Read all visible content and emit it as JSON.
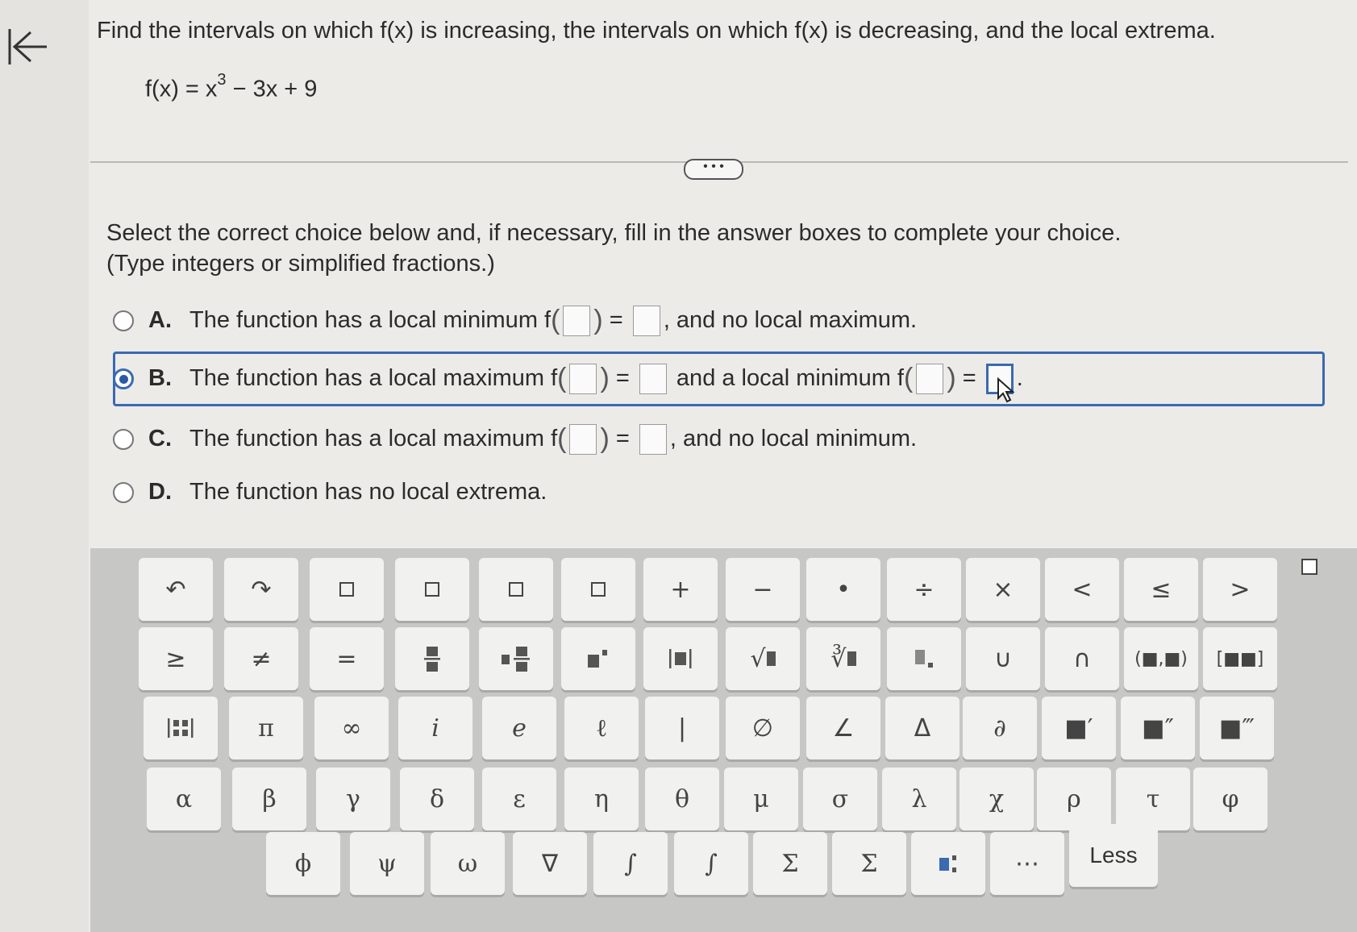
{
  "question": {
    "text": "Find the intervals on which f(x) is increasing, the intervals on which f(x) is decreasing, and the local extrema.",
    "formula_lhs": "f(x) = x",
    "formula_exp": "3",
    "formula_rhs": " − 3x + 9"
  },
  "more_button": "• • •",
  "instruction": {
    "line1": "Select the correct choice below and, if necessary, fill in the answer boxes to complete your choice.",
    "line2": "(Type integers or simplified fractions.)"
  },
  "choices": {
    "a": {
      "letter": "A.",
      "pre": "The function has a local minimum f",
      "mid": " = ",
      "post": ", and no local maximum."
    },
    "b": {
      "letter": "B.",
      "pre": "The function has a local maximum f",
      "mid": " = ",
      "mid2": " and a local minimum f",
      "mid3": " = ",
      "post": "."
    },
    "c": {
      "letter": "C.",
      "pre": "The function has a local maximum f",
      "mid": " = ",
      "post": ", and no local minimum."
    },
    "d": {
      "letter": "D.",
      "text": "The function has no local extrema."
    },
    "selected": "B"
  },
  "keyboard": {
    "row1": [
      "↶",
      "↷",
      "",
      "",
      "",
      "",
      "+",
      "−",
      "•",
      "÷",
      "×",
      "<",
      "≤",
      ">"
    ],
    "row2": [
      "≥",
      "≠",
      "=",
      "",
      "",
      "",
      "",
      "√",
      "∛",
      "",
      "∪",
      "∩",
      "(■,■)",
      "[■■]"
    ],
    "row3": [
      "",
      "π",
      "∞",
      "i",
      "e",
      "ℓ",
      "|",
      "∅",
      "∠",
      "Δ",
      "∂",
      "■′",
      "■″",
      "■‴"
    ],
    "row4": [
      "α",
      "β",
      "γ",
      "δ",
      "ε",
      "η",
      "θ",
      "μ",
      "σ",
      "λ",
      "χ",
      "ρ",
      "τ",
      "φ"
    ],
    "row5": [
      "ϕ",
      "ψ",
      "ω",
      "∇",
      "∫",
      "∫",
      "Σ",
      "Σ",
      "",
      "⋯",
      "Less"
    ]
  }
}
